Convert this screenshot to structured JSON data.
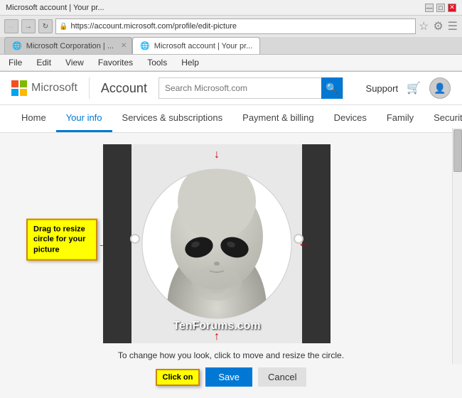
{
  "window": {
    "title": "Microsoft account | Your pr...",
    "titlebar_title": "Microsoft account | Your pr...",
    "controls": [
      "—",
      "□",
      "✕"
    ]
  },
  "browser": {
    "url": "https://account.microsoft.com/profile/edit-picture",
    "url_display": "https://account.microsoft.com/profile/edit-picture",
    "tab1_label": "Microsoft Corporation | ...",
    "tab2_label": "Microsoft account | Your pr...",
    "menu_items": [
      "File",
      "Edit",
      "View",
      "Favorites",
      "Tools",
      "Help"
    ]
  },
  "header": {
    "logo_text": "Microsoft",
    "account_label": "Account",
    "search_placeholder": "Search Microsoft.com",
    "support_label": "Support"
  },
  "nav": {
    "tabs": [
      {
        "label": "Home",
        "active": false
      },
      {
        "label": "Your info",
        "active": true
      },
      {
        "label": "Services & subscriptions",
        "active": false
      },
      {
        "label": "Payment & billing",
        "active": false
      },
      {
        "label": "Devices",
        "active": false
      },
      {
        "label": "Family",
        "active": false
      },
      {
        "label": "Security & privacy",
        "active": false
      }
    ]
  },
  "editor": {
    "watermark": "TenForums.com",
    "drag_tooltip": "Drag to resize circle for your picture",
    "caption": "To change how you look, click to move and resize the circle.",
    "click_tooltip": "Click on",
    "save_label": "Save",
    "cancel_label": "Cancel"
  }
}
